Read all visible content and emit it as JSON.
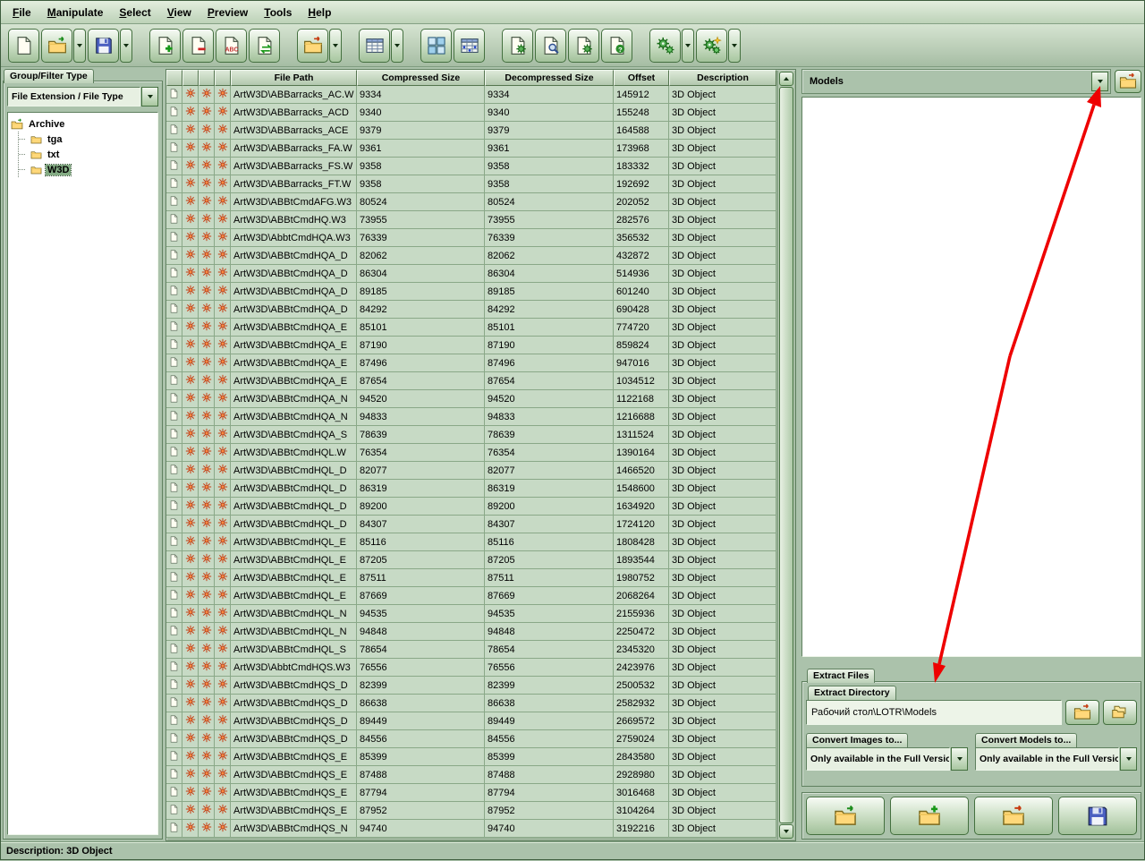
{
  "menu": {
    "items": [
      "File",
      "Manipulate",
      "Select",
      "View",
      "Preview",
      "Tools",
      "Help"
    ]
  },
  "toolbar": {
    "buttons": [
      {
        "name": "new",
        "icon": "page"
      },
      {
        "name": "open",
        "icon": "folder-open",
        "dropdown": true
      },
      {
        "name": "save",
        "icon": "floppy",
        "dropdown": true
      },
      {
        "sep": true
      },
      {
        "name": "add-file",
        "icon": "page-plus"
      },
      {
        "name": "delete-file",
        "icon": "page-minus"
      },
      {
        "name": "rename-file",
        "icon": "page-abc"
      },
      {
        "name": "replace-file",
        "icon": "page-swap"
      },
      {
        "sep": true
      },
      {
        "name": "extract",
        "icon": "folder-extract",
        "dropdown": true
      },
      {
        "sep": true
      },
      {
        "name": "list-view",
        "icon": "table",
        "dropdown": true
      },
      {
        "sep": true
      },
      {
        "name": "tile-view",
        "icon": "tiles"
      },
      {
        "name": "grid-view",
        "icon": "table-blue"
      },
      {
        "sep": true
      },
      {
        "name": "run-script",
        "icon": "page-gear"
      },
      {
        "name": "search",
        "icon": "page-find"
      },
      {
        "name": "edit-script",
        "icon": "page-gear2"
      },
      {
        "name": "help-file",
        "icon": "page-help"
      },
      {
        "sep": true
      },
      {
        "name": "settings",
        "icon": "gears",
        "dropdown": true
      },
      {
        "name": "tools-options",
        "icon": "gears2",
        "dropdown": true
      }
    ]
  },
  "left_panel": {
    "tab": "Group/Filter Type",
    "filter_combo": "File Extension / File Type",
    "tree": {
      "root": "Archive",
      "children": [
        {
          "label": "tga"
        },
        {
          "label": "txt"
        },
        {
          "label": "W3D",
          "selected": true
        }
      ]
    }
  },
  "table": {
    "headers": [
      "File Path",
      "Compressed Size",
      "Decompressed Size",
      "Offset",
      "Description"
    ],
    "rows": [
      [
        "ArtW3D\\ABBarracks_AC.W",
        "9334",
        "9334",
        "145912",
        "3D Object"
      ],
      [
        "ArtW3D\\ABBarracks_ACD",
        "9340",
        "9340",
        "155248",
        "3D Object"
      ],
      [
        "ArtW3D\\ABBarracks_ACE",
        "9379",
        "9379",
        "164588",
        "3D Object"
      ],
      [
        "ArtW3D\\ABBarracks_FA.W",
        "9361",
        "9361",
        "173968",
        "3D Object"
      ],
      [
        "ArtW3D\\ABBarracks_FS.W",
        "9358",
        "9358",
        "183332",
        "3D Object"
      ],
      [
        "ArtW3D\\ABBarracks_FT.W",
        "9358",
        "9358",
        "192692",
        "3D Object"
      ],
      [
        "ArtW3D\\ABBtCmdAFG.W3",
        "80524",
        "80524",
        "202052",
        "3D Object"
      ],
      [
        "ArtW3D\\ABBtCmdHQ.W3",
        "73955",
        "73955",
        "282576",
        "3D Object"
      ],
      [
        "ArtW3D\\AbbtCmdHQA.W3",
        "76339",
        "76339",
        "356532",
        "3D Object"
      ],
      [
        "ArtW3D\\ABBtCmdHQA_D",
        "82062",
        "82062",
        "432872",
        "3D Object"
      ],
      [
        "ArtW3D\\ABBtCmdHQA_D",
        "86304",
        "86304",
        "514936",
        "3D Object"
      ],
      [
        "ArtW3D\\ABBtCmdHQA_D",
        "89185",
        "89185",
        "601240",
        "3D Object"
      ],
      [
        "ArtW3D\\ABBtCmdHQA_D",
        "84292",
        "84292",
        "690428",
        "3D Object"
      ],
      [
        "ArtW3D\\ABBtCmdHQA_E",
        "85101",
        "85101",
        "774720",
        "3D Object"
      ],
      [
        "ArtW3D\\ABBtCmdHQA_E",
        "87190",
        "87190",
        "859824",
        "3D Object"
      ],
      [
        "ArtW3D\\ABBtCmdHQA_E",
        "87496",
        "87496",
        "947016",
        "3D Object"
      ],
      [
        "ArtW3D\\ABBtCmdHQA_E",
        "87654",
        "87654",
        "1034512",
        "3D Object"
      ],
      [
        "ArtW3D\\ABBtCmdHQA_N",
        "94520",
        "94520",
        "1122168",
        "3D Object"
      ],
      [
        "ArtW3D\\ABBtCmdHQA_N",
        "94833",
        "94833",
        "1216688",
        "3D Object"
      ],
      [
        "ArtW3D\\ABBtCmdHQA_S",
        "78639",
        "78639",
        "1311524",
        "3D Object"
      ],
      [
        "ArtW3D\\ABBtCmdHQL.W",
        "76354",
        "76354",
        "1390164",
        "3D Object"
      ],
      [
        "ArtW3D\\ABBtCmdHQL_D",
        "82077",
        "82077",
        "1466520",
        "3D Object"
      ],
      [
        "ArtW3D\\ABBtCmdHQL_D",
        "86319",
        "86319",
        "1548600",
        "3D Object"
      ],
      [
        "ArtW3D\\ABBtCmdHQL_D",
        "89200",
        "89200",
        "1634920",
        "3D Object"
      ],
      [
        "ArtW3D\\ABBtCmdHQL_D",
        "84307",
        "84307",
        "1724120",
        "3D Object"
      ],
      [
        "ArtW3D\\ABBtCmdHQL_E",
        "85116",
        "85116",
        "1808428",
        "3D Object"
      ],
      [
        "ArtW3D\\ABBtCmdHQL_E",
        "87205",
        "87205",
        "1893544",
        "3D Object"
      ],
      [
        "ArtW3D\\ABBtCmdHQL_E",
        "87511",
        "87511",
        "1980752",
        "3D Object"
      ],
      [
        "ArtW3D\\ABBtCmdHQL_E",
        "87669",
        "87669",
        "2068264",
        "3D Object"
      ],
      [
        "ArtW3D\\ABBtCmdHQL_N",
        "94535",
        "94535",
        "2155936",
        "3D Object"
      ],
      [
        "ArtW3D\\ABBtCmdHQL_N",
        "94848",
        "94848",
        "2250472",
        "3D Object"
      ],
      [
        "ArtW3D\\ABBtCmdHQL_S",
        "78654",
        "78654",
        "2345320",
        "3D Object"
      ],
      [
        "ArtW3D\\AbbtCmdHQS.W3",
        "76556",
        "76556",
        "2423976",
        "3D Object"
      ],
      [
        "ArtW3D\\ABBtCmdHQS_D",
        "82399",
        "82399",
        "2500532",
        "3D Object"
      ],
      [
        "ArtW3D\\ABBtCmdHQS_D",
        "86638",
        "86638",
        "2582932",
        "3D Object"
      ],
      [
        "ArtW3D\\ABBtCmdHQS_D",
        "89449",
        "89449",
        "2669572",
        "3D Object"
      ],
      [
        "ArtW3D\\ABBtCmdHQS_D",
        "84556",
        "84556",
        "2759024",
        "3D Object"
      ],
      [
        "ArtW3D\\ABBtCmdHQS_E",
        "85399",
        "85399",
        "2843580",
        "3D Object"
      ],
      [
        "ArtW3D\\ABBtCmdHQS_E",
        "87488",
        "87488",
        "2928980",
        "3D Object"
      ],
      [
        "ArtW3D\\ABBtCmdHQS_E",
        "87794",
        "87794",
        "3016468",
        "3D Object"
      ],
      [
        "ArtW3D\\ABBtCmdHQS_E",
        "87952",
        "87952",
        "3104264",
        "3D Object"
      ],
      [
        "ArtW3D\\ABBtCmdHQS_N",
        "94740",
        "94740",
        "3192216",
        "3D Object"
      ]
    ]
  },
  "right_panel": {
    "models_combo": "Models",
    "extract_files_tab": "Extract Files",
    "extract_directory_label": "Extract Directory",
    "extract_directory_value": "Рабочий стол\\LOTR\\Models",
    "convert_images_label": "Convert Images to...",
    "convert_models_label": "Convert Models to...",
    "convert_images_value": "Only available in the Full Version",
    "convert_models_value": "Only available in the Full Version",
    "action_buttons": [
      {
        "name": "open-archive",
        "icon": "folder-open"
      },
      {
        "name": "add-to-archive",
        "icon": "folder-plus"
      },
      {
        "name": "extract-archive",
        "icon": "folder-extract"
      },
      {
        "name": "save-archive",
        "icon": "floppy"
      }
    ]
  },
  "status_bar": {
    "text": "Description: 3D Object"
  },
  "colors": {
    "annotation_arrow": "#ee0000",
    "selection_green": "#84ac84",
    "panel_sage": "#abc2ab"
  }
}
